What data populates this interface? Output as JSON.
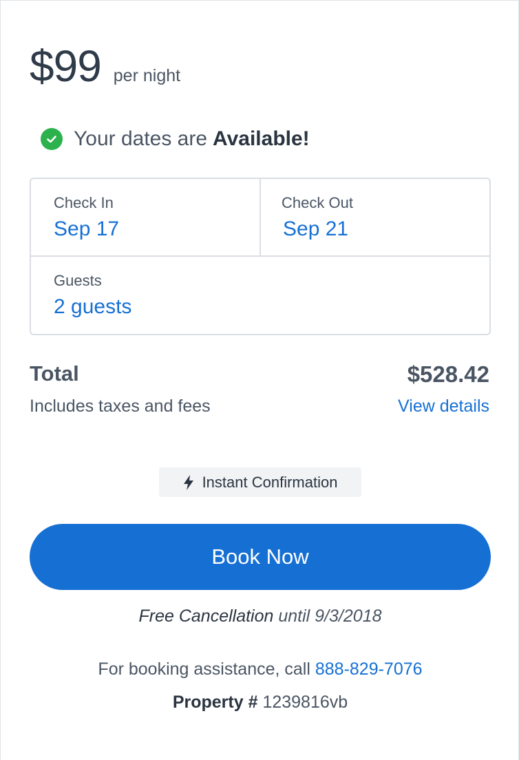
{
  "price": {
    "amount": "$99",
    "unit": "per night"
  },
  "availability": {
    "prefix": "Your dates are",
    "status": "Available!"
  },
  "booking": {
    "check_in_label": "Check In",
    "check_in_value": "Sep 17",
    "check_out_label": "Check Out",
    "check_out_value": "Sep 21",
    "guests_label": "Guests",
    "guests_value": "2 guests"
  },
  "total": {
    "label": "Total",
    "sub": "Includes taxes and fees",
    "amount": "$528.42",
    "details_link": "View details"
  },
  "badge": {
    "label": "Instant Confirmation"
  },
  "book_button": {
    "label": "Book Now"
  },
  "cancellation": {
    "strong": "Free Cancellation",
    "rest": "until 9/3/2018"
  },
  "assistance": {
    "text": "For booking assistance, call",
    "phone": "888-829-7076"
  },
  "property": {
    "label": "Property #",
    "id": "1239816vb"
  },
  "colors": {
    "accent": "#1670d4",
    "success": "#2bb24c",
    "text": "#4a5563",
    "heading": "#2a3440"
  },
  "icons": {
    "available": "check-circle-icon",
    "instant": "lightning-bolt-icon"
  }
}
